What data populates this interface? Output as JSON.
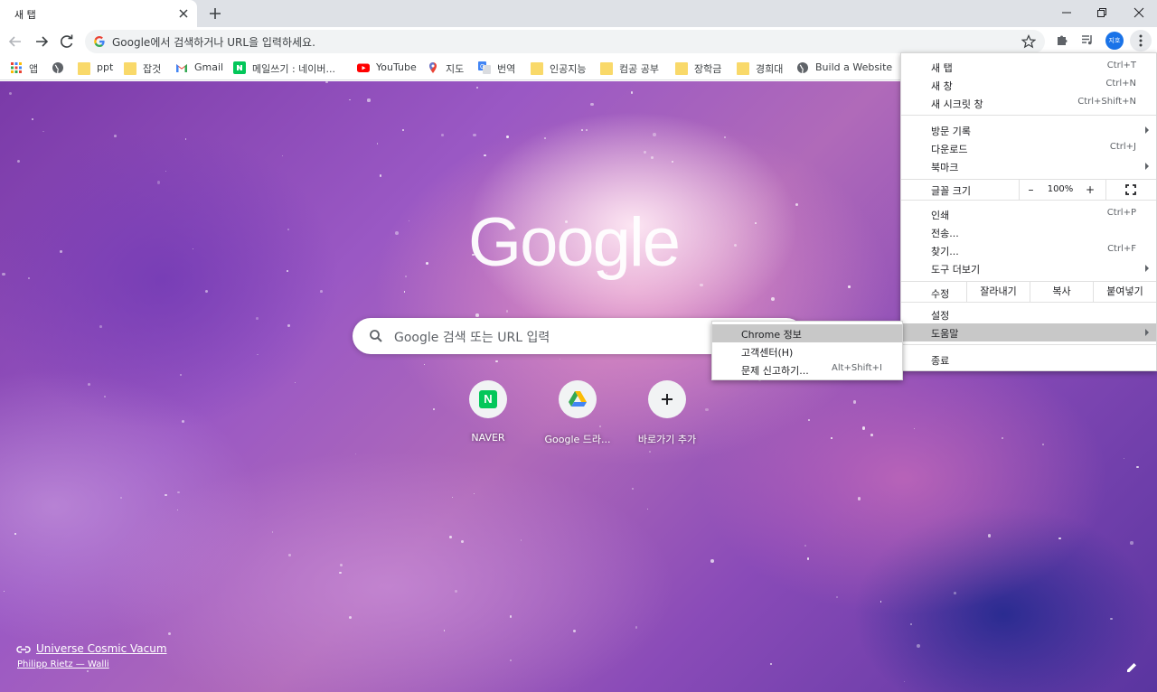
{
  "tab": {
    "title": "새 탭"
  },
  "omnibox": {
    "placeholder": "Google에서 검색하거나 URL을 입력하세요."
  },
  "profile": {
    "initials": "지호"
  },
  "bookmarks": [
    {
      "label": "앱",
      "icon": "apps-grid-icon"
    },
    {
      "label": "",
      "icon": "globe-icon"
    },
    {
      "label": "ppt",
      "icon": "folder-icon"
    },
    {
      "label": "잡것",
      "icon": "folder-icon"
    },
    {
      "label": "Gmail",
      "icon": "gmail-icon"
    },
    {
      "label": "메일쓰기 : 네이버...",
      "icon": "naver-icon"
    },
    {
      "label": "YouTube",
      "icon": "youtube-icon"
    },
    {
      "label": "지도",
      "icon": "maps-icon"
    },
    {
      "label": "번역",
      "icon": "translate-icon"
    },
    {
      "label": "인공지능",
      "icon": "folder-icon"
    },
    {
      "label": "컴공 공부",
      "icon": "folder-icon"
    },
    {
      "label": "장학금",
      "icon": "folder-icon"
    },
    {
      "label": "경희대",
      "icon": "folder-icon"
    },
    {
      "label": "Build a Website",
      "icon": "globe-icon"
    }
  ],
  "ntp": {
    "logo": "Google",
    "search_placeholder": "Google 검색 또는 URL 입력",
    "tiles": [
      {
        "label": "NAVER",
        "icon": "naver-icon"
      },
      {
        "label": "Google 드라...",
        "icon": "google-drive-icon"
      },
      {
        "label": "바로가기 추가",
        "icon": "plus-icon"
      }
    ],
    "attribution_title": "Universe Cosmic Vacum",
    "attribution_author": "Philipp Rietz — Walli"
  },
  "menu": {
    "new_tab": {
      "label": "새 탭",
      "shortcut": "Ctrl+T"
    },
    "new_window": {
      "label": "새 창",
      "shortcut": "Ctrl+N"
    },
    "incognito": {
      "label": "새 시크릿 창",
      "shortcut": "Ctrl+Shift+N"
    },
    "history": {
      "label": "방문 기록"
    },
    "downloads": {
      "label": "다운로드",
      "shortcut": "Ctrl+J"
    },
    "bookmarks": {
      "label": "북마크"
    },
    "zoom": {
      "label": "글꼴 크기",
      "minus": "–",
      "value": "100%",
      "plus": "+"
    },
    "print": {
      "label": "인쇄",
      "shortcut": "Ctrl+P"
    },
    "cast": {
      "label": "전송..."
    },
    "find": {
      "label": "찾기...",
      "shortcut": "Ctrl+F"
    },
    "more_tools": {
      "label": "도구 더보기"
    },
    "edit": {
      "label": "수정",
      "cut": "잘라내기",
      "copy": "복사",
      "paste": "붙여넣기"
    },
    "settings": {
      "label": "설정"
    },
    "help": {
      "label": "도움말"
    },
    "exit": {
      "label": "종료"
    }
  },
  "help_submenu": {
    "about": {
      "label": "Chrome 정보"
    },
    "help_center": {
      "label": "고객센터(H)"
    },
    "report": {
      "label": "문제 신고하기...",
      "shortcut": "Alt+Shift+I"
    }
  },
  "colors": {
    "accent": "#1a73e8",
    "tabstrip": "#dee1e6",
    "menu_highlight": "#c8c8c8"
  }
}
